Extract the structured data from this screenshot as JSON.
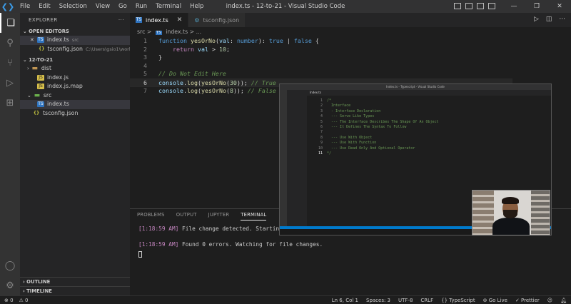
{
  "window": {
    "title": "index.ts - 12-to-21 - Visual Studio Code",
    "menu": [
      "File",
      "Edit",
      "Selection",
      "View",
      "Go",
      "Run",
      "Terminal",
      "Help"
    ]
  },
  "sidebar": {
    "header": "EXPLORER",
    "open_editors_label": "OPEN EDITORS",
    "open_editors": [
      {
        "name": "index.ts",
        "detail": "src",
        "selected": true,
        "icon": "ts-icon",
        "close": "✕"
      },
      {
        "name": "tsconfig.json",
        "detail": "C:\\Users\\gsio1\\workt...",
        "selected": false,
        "icon": "json-icon"
      }
    ],
    "workspace_label": "12-TO-21",
    "tree": [
      {
        "name": "dist",
        "type": "folder",
        "indent": 1
      },
      {
        "name": "index.js",
        "type": "js",
        "indent": 2
      },
      {
        "name": "index.js.map",
        "type": "js",
        "indent": 2
      },
      {
        "name": "src",
        "type": "folder",
        "indent": 1
      },
      {
        "name": "index.ts",
        "type": "ts",
        "indent": 2,
        "selected": true
      },
      {
        "name": "tsconfig.json",
        "type": "json",
        "indent": 1
      }
    ],
    "outline_label": "OUTLINE",
    "timeline_label": "TIMELINE"
  },
  "tabs": [
    {
      "label": "index.ts",
      "active": true,
      "close": "✕"
    },
    {
      "label": "tsconfig.json",
      "active": false
    }
  ],
  "breadcrumb": {
    "folder": "src",
    "sep": ">",
    "file": "index.ts",
    "rest": "> ..."
  },
  "code": {
    "lines": [
      {
        "n": "1",
        "html": "<span class='kw'>function</span> <span class='fn'>yesOrNo</span><span class='op'>(</span><span class='pm'>val</span><span class='op'>: </span><span class='ty'>number</span><span class='op'>): </span><span class='ty'>true</span><span class='op'> | </span><span class='ty'>false</span><span class='op'> {</span>"
      },
      {
        "n": "2",
        "html": "    <span class='kw2'>return</span> <span class='pm'>val</span><span class='op'> &gt; </span><span class='num'>10</span><span class='op'>;</span>"
      },
      {
        "n": "3",
        "html": "<span class='op'>}</span>"
      },
      {
        "n": "4",
        "html": ""
      },
      {
        "n": "5",
        "html": "<span class='cm'>// Do Not Edit Here</span>"
      },
      {
        "n": "6",
        "html": "<span class='pm'>console</span><span class='op'>.</span><span class='fn'>log</span><span class='op'>(</span><span class='fn'>yesOrNo</span><span class='op'>(</span><span class='num'>30</span><span class='op'>)); </span><span class='cm'>// True</span>",
        "current": true
      },
      {
        "n": "7",
        "html": "<span class='pm'>console</span><span class='op'>.</span><span class='fn'>log</span><span class='op'>(</span><span class='fn'>yesOrNo</span><span class='op'>(</span><span class='num'>8</span><span class='op'>)); </span><span class='cm'>// False</span>"
      }
    ]
  },
  "panel": {
    "tabs": [
      "PROBLEMS",
      "OUTPUT",
      "JUPYTER",
      "TERMINAL"
    ],
    "active_tab": "TERMINAL",
    "terminal": [
      {
        "time": "[1:18:59 AM]",
        "text": " File change detected. Starting incre"
      },
      {
        "time": "",
        "text": ""
      },
      {
        "time": "[1:18:59 AM]",
        "text": " Found 0 errors. Watching for file changes."
      }
    ]
  },
  "overlay": {
    "title": "Index.ts - Typescript - Visual Studio Code",
    "tab": "Index.ts",
    "lines": [
      {
        "n": "1",
        "t": "/*"
      },
      {
        "n": "2",
        "t": "  Interface"
      },
      {
        "n": "3",
        "t": "  - Interface Declaration"
      },
      {
        "n": "4",
        "t": "  --- Serve Like Types"
      },
      {
        "n": "5",
        "t": "  --- The Interface Describes The Shape Of An Object"
      },
      {
        "n": "6",
        "t": "  --- It Defines The Syntax To Follow"
      },
      {
        "n": "7",
        "t": ""
      },
      {
        "n": "8",
        "t": "  --- Use With Object"
      },
      {
        "n": "9",
        "t": "  --- Use With Function"
      },
      {
        "n": "10",
        "t": "  --- Use Read Only And Optional Operator"
      },
      {
        "n": "11",
        "t": "*/"
      }
    ]
  },
  "statusbar": {
    "errors": "⊗ 0",
    "warnings": "⚠ 0",
    "position": "Ln 6, Col 1",
    "spaces": "Spaces: 3",
    "encoding": "UTF-8",
    "eol": "CRLF",
    "language": "{} TypeScript",
    "golive": "⊚ Go Live",
    "prettier": "✓ Prettier"
  },
  "colors": {
    "accent": "#007acc",
    "ts_icon": "#2f74c0",
    "comment": "#6a9955"
  }
}
